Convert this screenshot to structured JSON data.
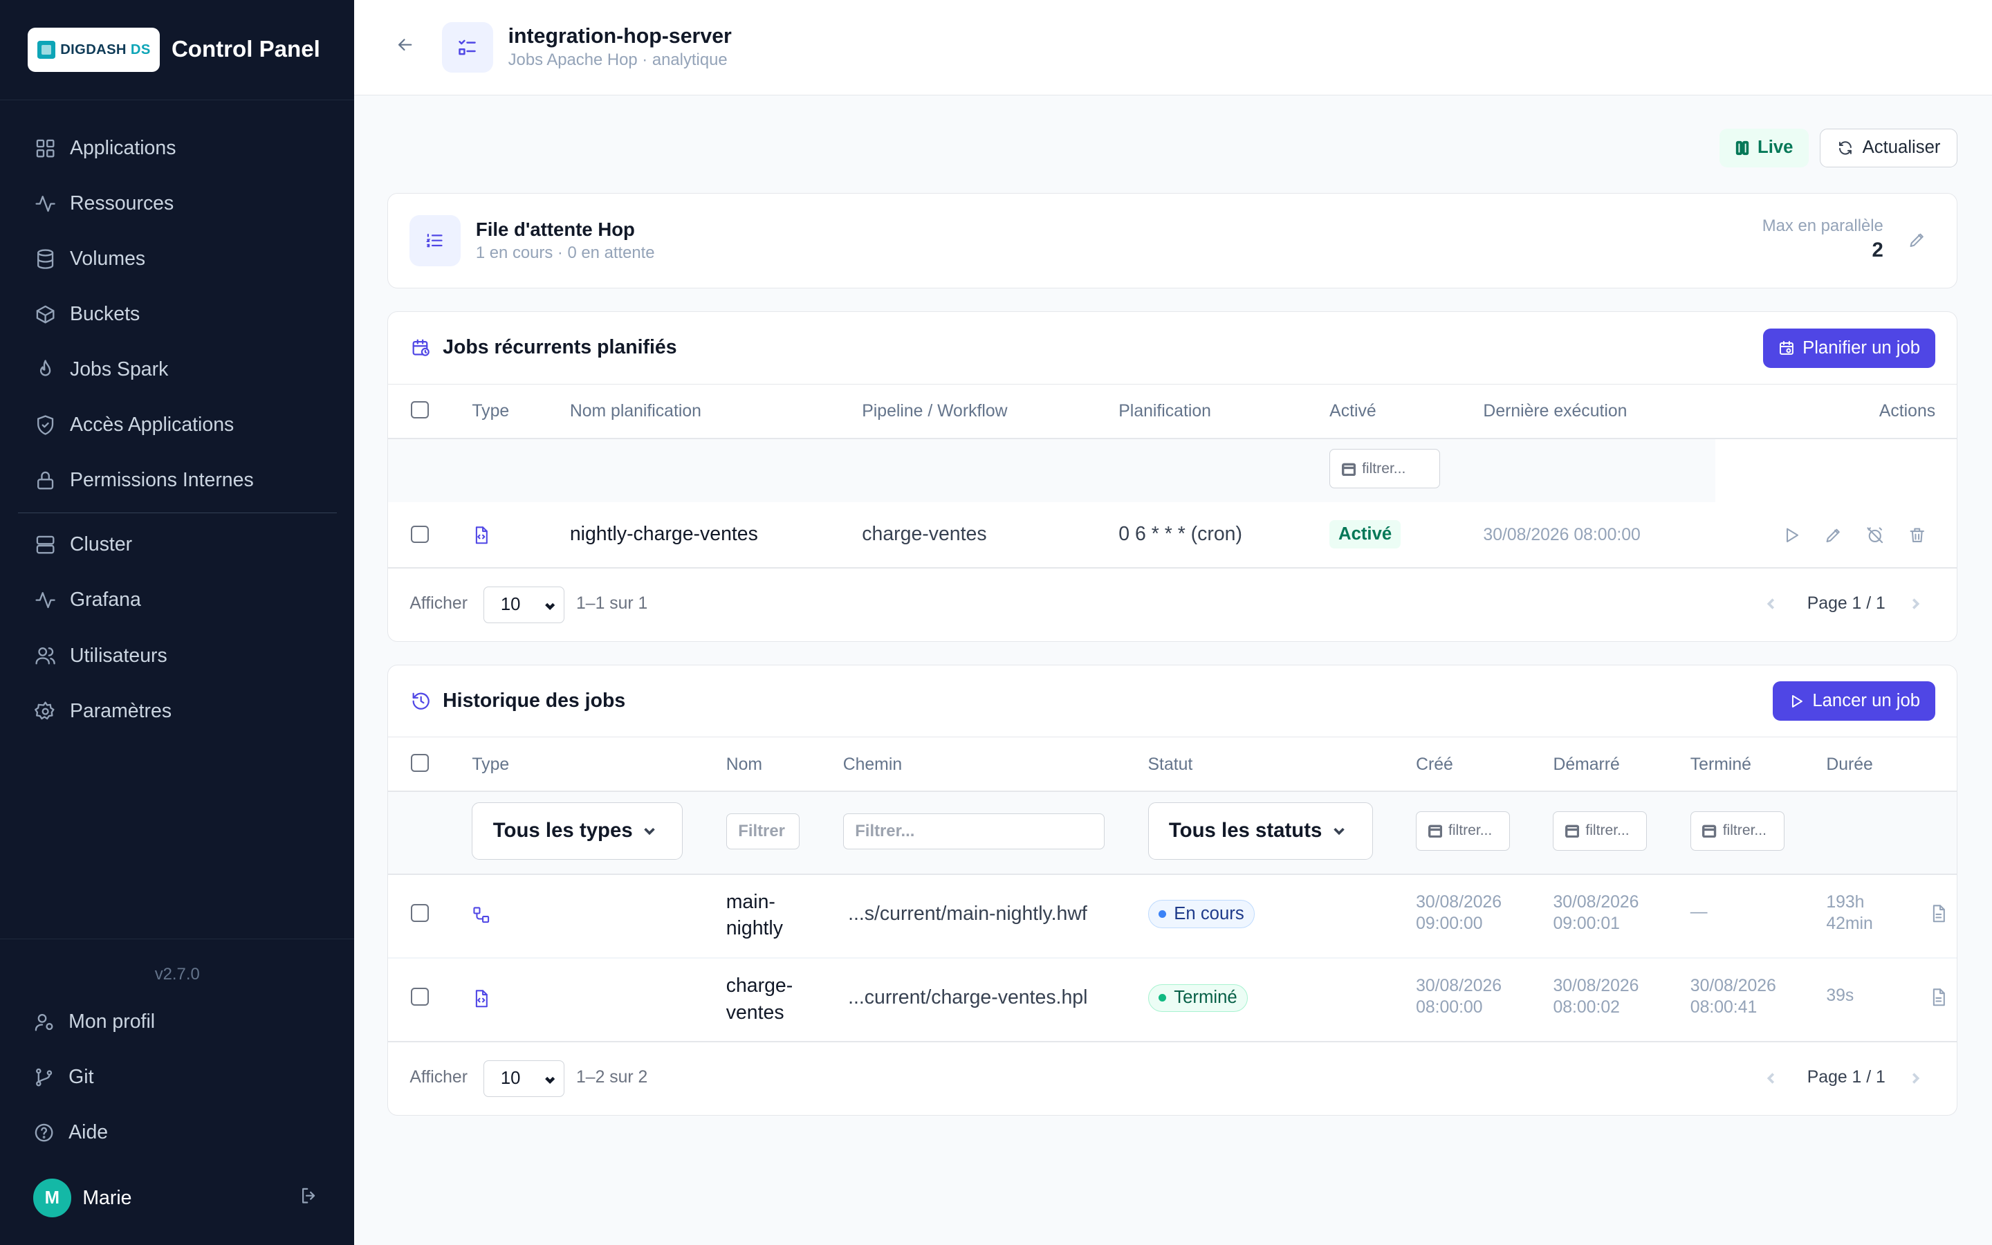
{
  "brand": {
    "logo_main": "DIGDASH",
    "logo_accent": "DS",
    "title": "Control Panel"
  },
  "sidebar": {
    "items": [
      {
        "label": "Applications",
        "icon": "grid-icon"
      },
      {
        "label": "Ressources",
        "icon": "activity-icon"
      },
      {
        "label": "Volumes",
        "icon": "database-icon"
      },
      {
        "label": "Buckets",
        "icon": "box-icon"
      },
      {
        "label": "Jobs Spark",
        "icon": "flame-icon"
      },
      {
        "label": "Accès Applications",
        "icon": "shield-icon"
      },
      {
        "label": "Permissions Internes",
        "icon": "lock-icon"
      },
      {
        "label": "Cluster",
        "icon": "server-icon"
      },
      {
        "label": "Grafana",
        "icon": "activity-icon"
      },
      {
        "label": "Utilisateurs",
        "icon": "users-icon"
      },
      {
        "label": "Paramètres",
        "icon": "gear-icon"
      }
    ],
    "version": "v2.7.0",
    "bottom": [
      {
        "label": "Mon profil",
        "icon": "user-gear-icon"
      },
      {
        "label": "Git",
        "icon": "git-branch-icon"
      },
      {
        "label": "Aide",
        "icon": "help-icon"
      }
    ],
    "user": {
      "initial": "M",
      "name": "Marie"
    }
  },
  "header": {
    "title": "integration-hop-server",
    "subtitle": "Jobs Apache Hop · analytique"
  },
  "toolbar": {
    "live": "Live",
    "refresh": "Actualiser"
  },
  "queue": {
    "title": "File d'attente Hop",
    "subtitle": "1 en cours · 0 en attente",
    "max_label": "Max en parallèle",
    "max_value": "2"
  },
  "scheduled": {
    "title": "Jobs récurrents planifiés",
    "button": "Planifier un job",
    "columns": [
      "Type",
      "Nom planification",
      "Pipeline / Workflow",
      "Planification",
      "Activé",
      "Dernière exécution",
      "Actions"
    ],
    "filter_placeholder": "filtrer...",
    "rows": [
      {
        "type_icon": "pipeline-file-icon",
        "name": "nightly-charge-ventes",
        "pipeline": "charge-ventes",
        "schedule": "0 6 * * * (cron)",
        "enabled": "Activé",
        "last_run": "30/08/2026 08:00:00"
      }
    ],
    "pager": {
      "show": "Afficher",
      "size": "10",
      "range": "1–1 sur 1",
      "page": "Page 1 / 1"
    }
  },
  "history": {
    "title": "Historique des jobs",
    "button": "Lancer un job",
    "columns": [
      "Type",
      "Nom",
      "Chemin",
      "Statut",
      "Créé",
      "Démarré",
      "Terminé",
      "Durée"
    ],
    "filters": {
      "type": "Tous les types",
      "name": "Filtrer",
      "path": "Filtrer...",
      "status": "Tous les statuts",
      "date": "filtrer..."
    },
    "rows": [
      {
        "type_icon": "workflow-icon",
        "name_1": "main-",
        "name_2": "nightly",
        "path": "...s/current/main-nightly.hwf",
        "status": "En cours",
        "created_1": "30/08/2026",
        "created_2": "09:00:00",
        "started_1": "30/08/2026",
        "started_2": "09:00:01",
        "ended_1": "—",
        "ended_2": "",
        "duration_1": "193h",
        "duration_2": "42min"
      },
      {
        "type_icon": "pipeline-file-icon",
        "name_1": "charge-",
        "name_2": "ventes",
        "path": "...current/charge-ventes.hpl",
        "status": "Terminé",
        "created_1": "30/08/2026",
        "created_2": "08:00:00",
        "started_1": "30/08/2026",
        "started_2": "08:00:02",
        "ended_1": "30/08/2026",
        "ended_2": "08:00:41",
        "duration_1": "39s",
        "duration_2": ""
      }
    ],
    "pager": {
      "show": "Afficher",
      "size": "10",
      "range": "1–2 sur 2",
      "page": "Page 1 / 1"
    }
  },
  "colors": {
    "sidebar_bg": "#0f172a",
    "accent": "#4f46e5",
    "live_green": "#047857",
    "avatar": "#14b8a6"
  }
}
